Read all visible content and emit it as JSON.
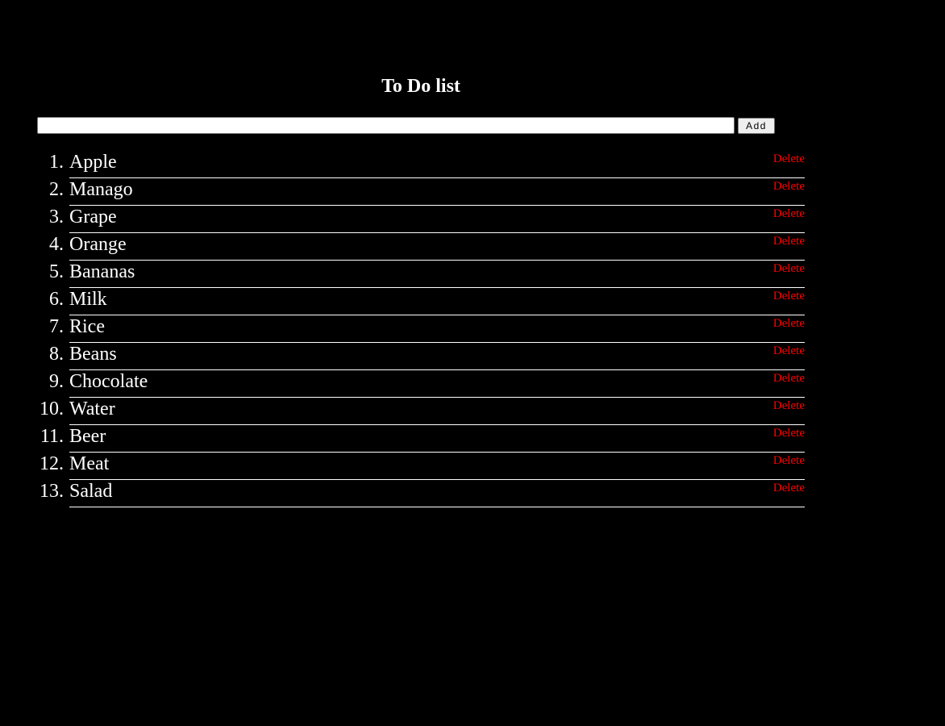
{
  "header": {
    "title": "To Do list"
  },
  "add_form": {
    "input_value": "",
    "input_placeholder": "",
    "add_label": "Add"
  },
  "delete_label": "Delete",
  "items": [
    {
      "number": "1.",
      "text": "Apple"
    },
    {
      "number": "2.",
      "text": "Manago"
    },
    {
      "number": "3.",
      "text": "Grape"
    },
    {
      "number": "4.",
      "text": "Orange"
    },
    {
      "number": "5.",
      "text": "Bananas"
    },
    {
      "number": "6.",
      "text": "Milk"
    },
    {
      "number": "7.",
      "text": "Rice"
    },
    {
      "number": "8.",
      "text": "Beans"
    },
    {
      "number": "9.",
      "text": "Chocolate"
    },
    {
      "number": "10.",
      "text": "Water"
    },
    {
      "number": "11.",
      "text": "Beer"
    },
    {
      "number": "12.",
      "text": "Meat"
    },
    {
      "number": "13.",
      "text": "Salad"
    }
  ],
  "colors": {
    "background": "#000000",
    "text": "#ffffff",
    "delete": "#ff0000"
  }
}
